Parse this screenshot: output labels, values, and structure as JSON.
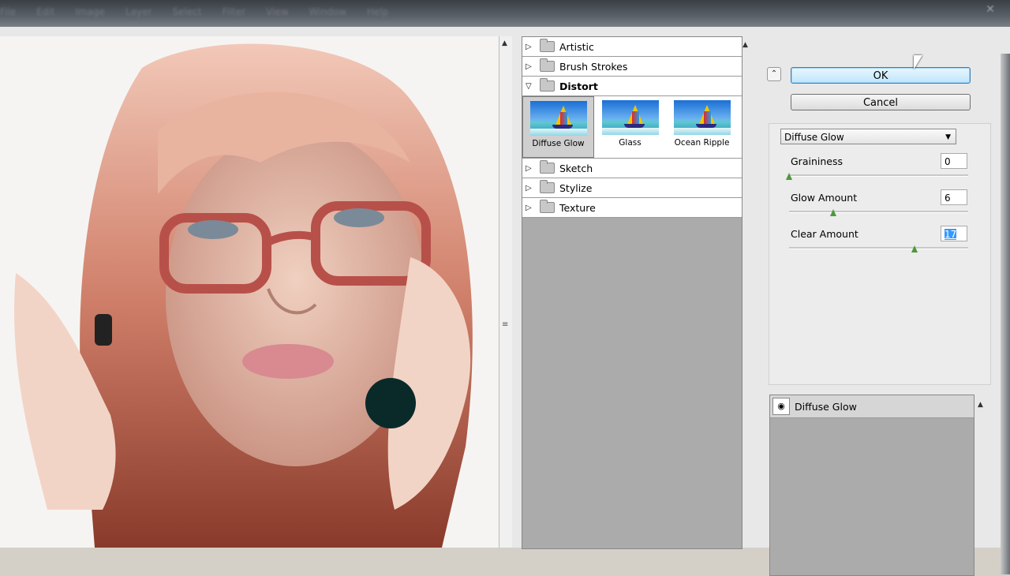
{
  "menu": [
    "File",
    "Edit",
    "Image",
    "Layer",
    "Select",
    "Filter",
    "View",
    "Window",
    "Help"
  ],
  "filter_categories": [
    {
      "label": "Artistic",
      "open": false
    },
    {
      "label": "Brush Strokes",
      "open": false
    },
    {
      "label": "Distort",
      "open": true
    },
    {
      "label": "Sketch",
      "open": false
    },
    {
      "label": "Stylize",
      "open": false
    },
    {
      "label": "Texture",
      "open": false
    }
  ],
  "distort_thumbs": [
    {
      "label": "Diffuse Glow",
      "selected": true
    },
    {
      "label": "Glass",
      "selected": false
    },
    {
      "label": "Ocean Ripple",
      "selected": false
    }
  ],
  "buttons": {
    "ok": "OK",
    "cancel": "Cancel"
  },
  "filter_select": {
    "value": "Diffuse Glow"
  },
  "params": [
    {
      "label": "Graininess",
      "value": "0",
      "level": 0.0
    },
    {
      "label": "Glow Amount",
      "value": "6",
      "level": 0.3
    },
    {
      "label": "Clear Amount",
      "value": "17",
      "level": 0.85
    }
  ],
  "layer": {
    "name": "Diffuse Glow"
  },
  "icons": {
    "collapse": "double-chevron-up-icon",
    "eye": "eye-icon",
    "folder": "folder-icon"
  }
}
